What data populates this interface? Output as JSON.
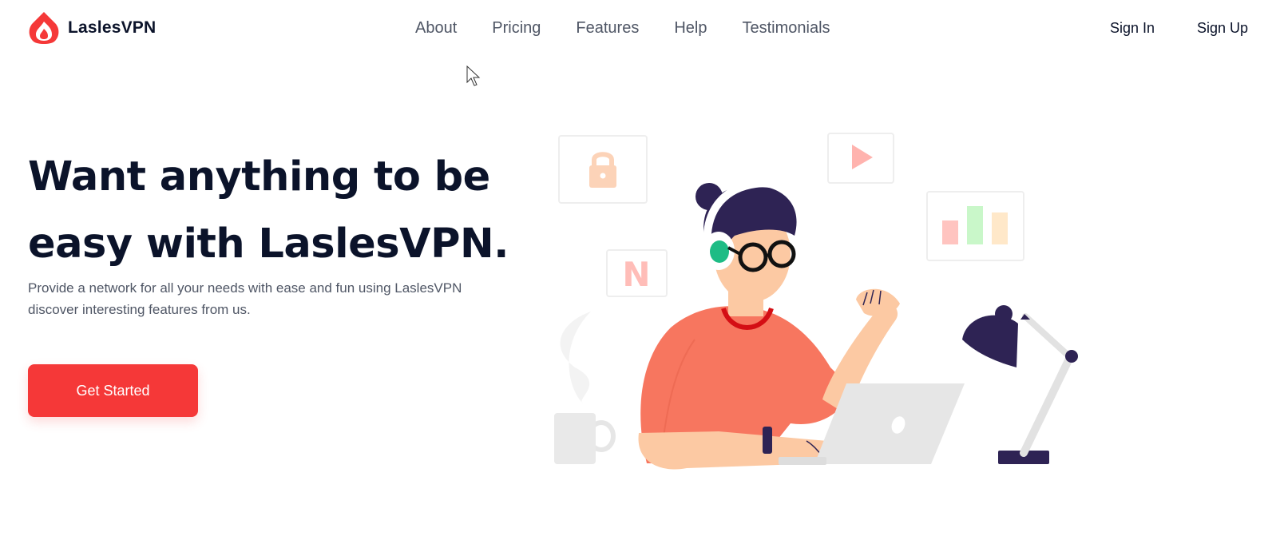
{
  "brand": {
    "name": "LaslesVPN",
    "accent": "#f53838"
  },
  "nav": {
    "items": [
      {
        "label": "About"
      },
      {
        "label": "Pricing"
      },
      {
        "label": "Features"
      },
      {
        "label": "Help"
      },
      {
        "label": "Testimonials"
      }
    ]
  },
  "auth": {
    "sign_in": "Sign In",
    "sign_up": "Sign Up"
  },
  "hero": {
    "headline": "Want anything to be easy with LaslesVPN.",
    "description": "Provide a network for all your needs with ease and fun using LaslesVPN discover interesting features from us.",
    "cta_label": "Get Started"
  },
  "illustration": {
    "icons": [
      "lock-icon",
      "play-icon",
      "netflix-icon",
      "bar-chart-icon",
      "desk-lamp-icon",
      "mug-icon",
      "laptop-icon"
    ],
    "letter": "N"
  }
}
